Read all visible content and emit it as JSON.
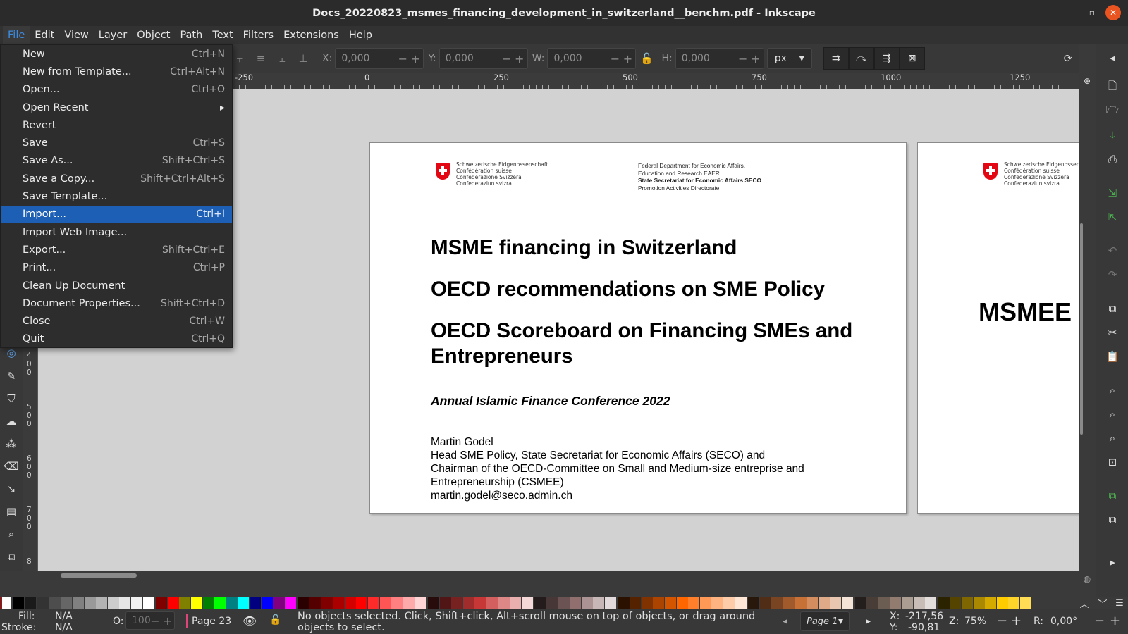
{
  "window": {
    "title": "Docs_20220823_msmes_financing_development_in_switzerland__benchm.pdf - Inkscape",
    "minimize_glyph": "–",
    "maximize_glyph": "▫",
    "close_glyph": "✕"
  },
  "menubar": [
    "File",
    "Edit",
    "View",
    "Layer",
    "Object",
    "Path",
    "Text",
    "Filters",
    "Extensions",
    "Help"
  ],
  "file_menu": [
    {
      "label": "New",
      "shortcut": "Ctrl+N"
    },
    {
      "label": "New from Template...",
      "shortcut": "Ctrl+Alt+N"
    },
    {
      "label": "Open...",
      "shortcut": "Ctrl+O"
    },
    {
      "label": "Open Recent",
      "shortcut": "▸"
    },
    {
      "label": "Revert",
      "shortcut": ""
    },
    {
      "label": "Save",
      "shortcut": "Ctrl+S"
    },
    {
      "label": "Save As...",
      "shortcut": "Shift+Ctrl+S"
    },
    {
      "label": "Save a Copy...",
      "shortcut": "Shift+Ctrl+Alt+S"
    },
    {
      "label": "Save Template...",
      "shortcut": ""
    },
    {
      "label": "Import...",
      "shortcut": "Ctrl+I"
    },
    {
      "label": "Import Web Image...",
      "shortcut": ""
    },
    {
      "label": "Export...",
      "shortcut": "Shift+Ctrl+E"
    },
    {
      "label": "Print...",
      "shortcut": "Ctrl+P"
    },
    {
      "label": "Clean Up Document",
      "shortcut": ""
    },
    {
      "label": "Document Properties...",
      "shortcut": "Shift+Ctrl+D"
    },
    {
      "label": "Close",
      "shortcut": "Ctrl+W"
    },
    {
      "label": "Quit",
      "shortcut": "Ctrl+Q"
    }
  ],
  "file_menu_active": "Import...",
  "toolbar": {
    "x_label": "X:",
    "x_value": "0,000",
    "y_label": "Y:",
    "y_value": "0,000",
    "w_label": "W:",
    "w_value": "0,000",
    "h_label": "H:",
    "h_value": "0,000",
    "unit": "px",
    "minus": "−",
    "plus": "+"
  },
  "ruler_h": [
    "-250",
    "0",
    "250",
    "500",
    "750",
    "1000",
    "1250"
  ],
  "ruler_v_groups": [
    "4 0 0",
    "5 0 0",
    "6 0 0",
    "7 0 0",
    "8"
  ],
  "page1": {
    "confed": [
      "Schweizerische Eidgenossenschaft",
      "Confédération suisse",
      "Confederazione Svizzera",
      "Confederaziun svizra"
    ],
    "dept_line1": "Federal Department for Economic Affairs,",
    "dept_line2": "Education and Research EAER",
    "dept_line3": "State Secretariat for Economic Affairs SECO",
    "dept_line4": "Promotion Activities Directorate",
    "heading1": "MSME financing in Switzerland",
    "heading2": "OECD recommendations on SME Policy",
    "heading3_line1": "OECD Scoreboard on Financing SMEs and",
    "heading3_line2": "Entrepreneurs",
    "conference": "Annual Islamic Finance Conference 2022",
    "author_lines": [
      "Martin Godel",
      "Head SME Policy, State Secretariat for Economic Affairs (SECO) and",
      "Chairman of the OECD-Committee on Small and Medium-size entreprise and",
      "Entrepreneurship (CSMEE)",
      "martin.godel@seco.admin.ch"
    ]
  },
  "page2": {
    "confed": [
      "Schweizerische Eidgenossenschaft",
      "Confédération suisse",
      "Confederazione Svizzera",
      "Confederaziun svizra"
    ],
    "heading": "MSMEE"
  },
  "status": {
    "fill_label": "Fill:",
    "fill_value": "N/A",
    "stroke_label": "Stroke:",
    "stroke_value": "N/A",
    "opacity_label": "O:",
    "opacity_value": "100",
    "layer": "Page 23",
    "message": "No objects selected. Click, Shift+click, Alt+scroll mouse on top of objects, or drag around objects to select.",
    "page_select": "Page 1",
    "cursor_x_label": "X:",
    "cursor_x": "-217,56",
    "cursor_y_label": "Y:",
    "cursor_y": "-90,81",
    "zoom_label": "Z:",
    "zoom": "75%",
    "rotation_label": "R:",
    "rotation": "0,00°"
  },
  "colors": {
    "accent": "#1c5fb5",
    "menu_active_text": "#3d8be0",
    "swiss_red": "#e30613",
    "close_button": "#e95420",
    "layer_marker": "#e0457a"
  },
  "icons": {
    "toolbox": [
      "spiral-icon",
      "dropper-icon",
      "paint-bucket-icon",
      "tweak-icon",
      "spray-icon",
      "eraser-icon",
      "connector-icon",
      "pages-icon",
      "zoom-icon",
      "clone-icon"
    ],
    "right_bar": [
      "new-document-icon",
      "open-folder-icon",
      "save-icon",
      "print-icon",
      "import-icon",
      "export-icon",
      "undo-icon",
      "redo-icon",
      "copy-icon",
      "cut-icon",
      "paste-icon",
      "zoom-selection-icon",
      "zoom-drawing-icon",
      "zoom-page-icon",
      "zoom-center-icon",
      "duplicate-icon",
      "clone-icon"
    ]
  }
}
